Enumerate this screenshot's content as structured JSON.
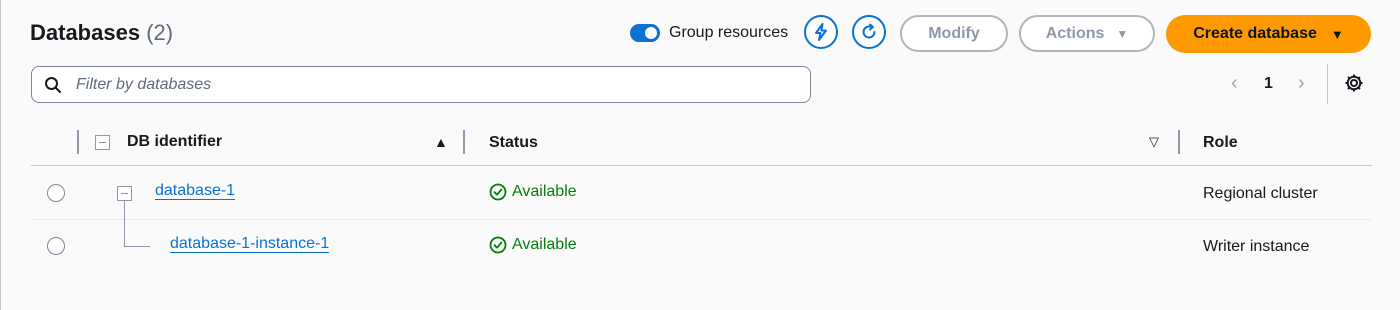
{
  "header": {
    "title": "Databases",
    "count": "(2)",
    "group_toggle_label": "Group resources",
    "group_toggle_on": true,
    "buttons": {
      "quick_action_icon": "lightning-icon",
      "refresh_icon": "refresh-icon",
      "modify": "Modify",
      "actions": "Actions",
      "create": "Create database"
    }
  },
  "filter": {
    "placeholder": "Filter by databases",
    "value": ""
  },
  "pagination": {
    "current_page": "1"
  },
  "table": {
    "columns": {
      "identifier": "DB identifier",
      "status": "Status",
      "role": "Role"
    },
    "rows": [
      {
        "identifier": "database-1",
        "status": "Available",
        "role": "Regional cluster"
      },
      {
        "identifier": "database-1-instance-1",
        "status": "Available",
        "role": "Writer instance"
      }
    ]
  },
  "colors": {
    "accent": "#0972d3",
    "primary_button": "#ff9900",
    "status_ok": "#037f0c"
  }
}
